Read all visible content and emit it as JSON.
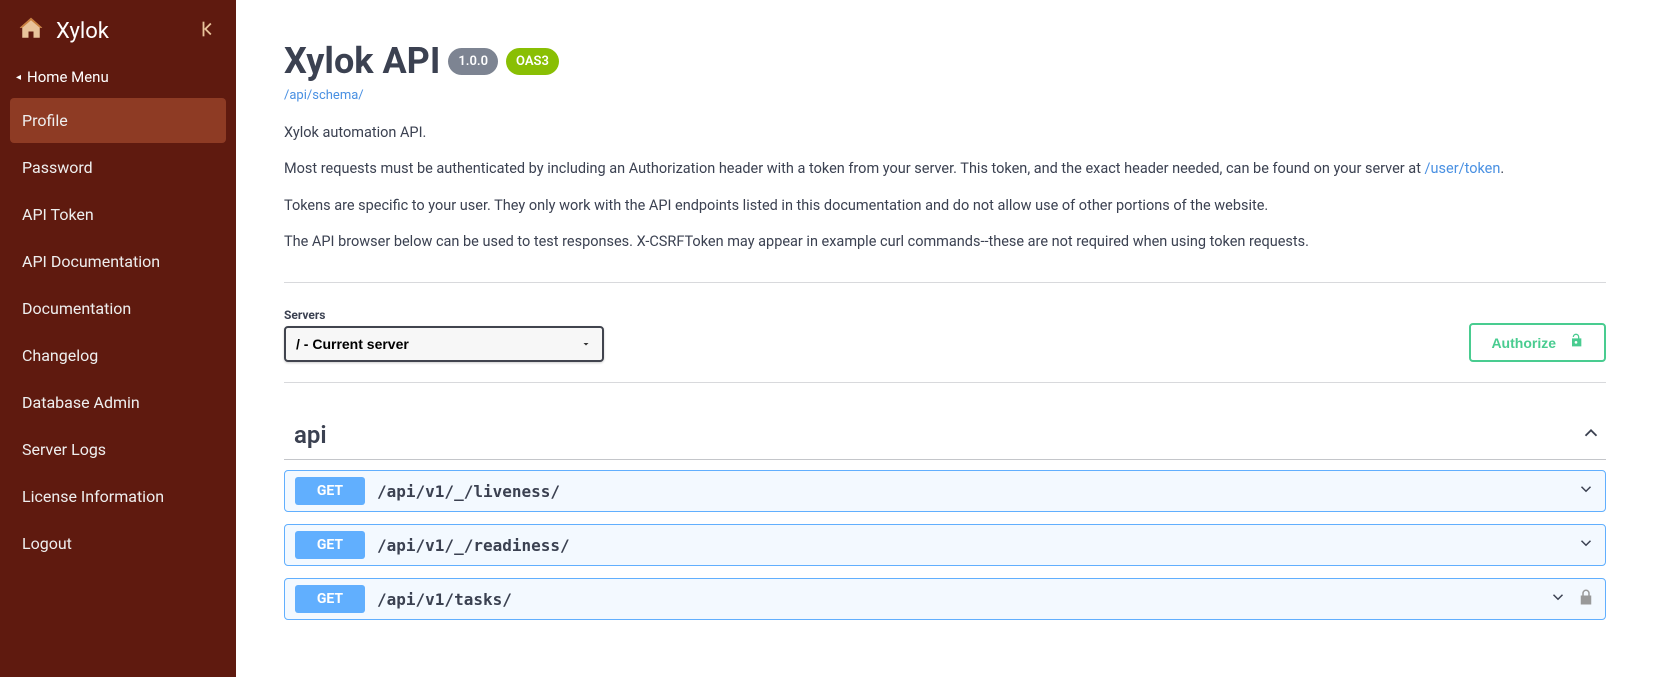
{
  "brand": {
    "name": "Xylok"
  },
  "sidebar": {
    "menu_header": "Home Menu",
    "items": [
      {
        "label": "Profile",
        "active": true
      },
      {
        "label": "Password",
        "active": false
      },
      {
        "label": "API Token",
        "active": false
      },
      {
        "label": "API Documentation",
        "active": false
      },
      {
        "label": "Documentation",
        "active": false
      },
      {
        "label": "Changelog",
        "active": false
      },
      {
        "label": "Database Admin",
        "active": false
      },
      {
        "label": "Server Logs",
        "active": false
      },
      {
        "label": "License Information",
        "active": false
      },
      {
        "label": "Logout",
        "active": false
      }
    ]
  },
  "api": {
    "title": "Xylok API",
    "version": "1.0.0",
    "oas_badge": "OAS3",
    "schema_link": "/api/schema/",
    "description": {
      "p1": "Xylok automation API.",
      "p2_pre": "Most requests must be authenticated by including an Authorization header with a token from your server. This token, and the exact header needed, can be found on your server at ",
      "p2_link": "/user/token",
      "p2_post": ".",
      "p3": "Tokens are specific to your user. They only work with the API endpoints listed in this documentation and do not allow use of other portions of the website.",
      "p4": "The API browser below can be used to test responses. X-CSRFToken may appear in example curl commands--these are not required when using token requests."
    }
  },
  "servers": {
    "label": "Servers",
    "selected": "/ - Current server"
  },
  "authorize": {
    "label": "Authorize"
  },
  "tag": {
    "name": "api",
    "operations": [
      {
        "method": "GET",
        "path": "/api/v1/_/liveness/",
        "locked": false
      },
      {
        "method": "GET",
        "path": "/api/v1/_/readiness/",
        "locked": false
      },
      {
        "method": "GET",
        "path": "/api/v1/tasks/",
        "locked": true
      }
    ]
  }
}
